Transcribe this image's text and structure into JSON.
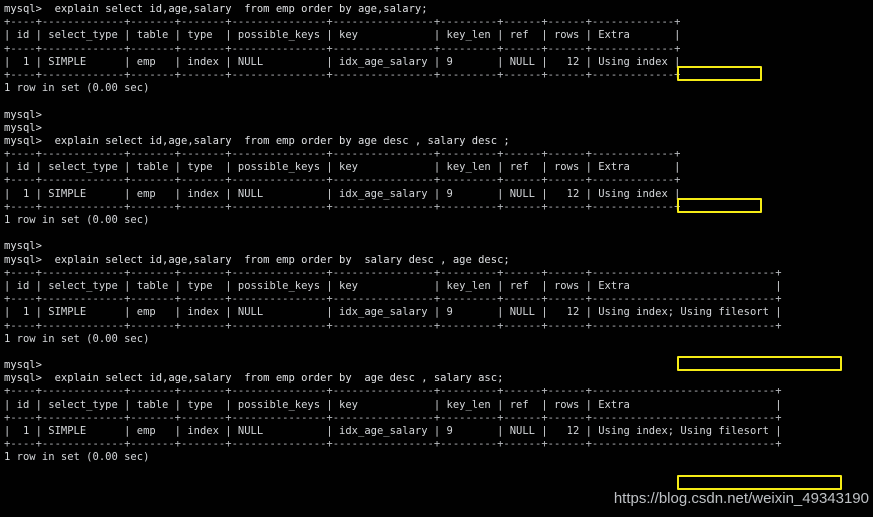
{
  "terminal": {
    "prompt": "mysql>",
    "colors": {
      "background": "#010101",
      "text": "#d4d7da",
      "highlight_border": "#f5eb16",
      "watermark": "#cfd2d6"
    },
    "lines": [
      "mysql>  explain select id,age,salary  from emp order by age,salary;",
      "+----+-------------+-------+-------+---------------+----------------+---------+------+------+-------------+",
      "| id | select_type | table | type  | possible_keys | key            | key_len | ref  | rows | Extra       |",
      "+----+-------------+-------+-------+---------------+----------------+---------+------+------+-------------+",
      "|  1 | SIMPLE      | emp   | index | NULL          | idx_age_salary | 9       | NULL |   12 | Using index |",
      "+----+-------------+-------+-------+---------------+----------------+---------+------+------+-------------+",
      "1 row in set (0.00 sec)",
      "",
      "mysql>",
      "mysql>",
      "mysql>  explain select id,age,salary  from emp order by age desc , salary desc ;",
      "+----+-------------+-------+-------+---------------+----------------+---------+------+------+-------------+",
      "| id | select_type | table | type  | possible_keys | key            | key_len | ref  | rows | Extra       |",
      "+----+-------------+-------+-------+---------------+----------------+---------+------+------+-------------+",
      "|  1 | SIMPLE      | emp   | index | NULL          | idx_age_salary | 9       | NULL |   12 | Using index |",
      "+----+-------------+-------+-------+---------------+----------------+---------+------+------+-------------+",
      "1 row in set (0.00 sec)",
      "",
      "mysql>",
      "mysql>  explain select id,age,salary  from emp order by  salary desc , age desc;",
      "+----+-------------+-------+-------+---------------+----------------+---------+------+------+-----------------------------+",
      "| id | select_type | table | type  | possible_keys | key            | key_len | ref  | rows | Extra                       |",
      "+----+-------------+-------+-------+---------------+----------------+---------+------+------+-----------------------------+",
      "|  1 | SIMPLE      | emp   | index | NULL          | idx_age_salary | 9       | NULL |   12 | Using index; Using filesort |",
      "+----+-------------+-------+-------+---------------+----------------+---------+------+------+-----------------------------+",
      "1 row in set (0.00 sec)",
      "",
      "mysql>",
      "mysql>  explain select id,age,salary  from emp order by  age desc , salary asc;",
      "+----+-------------+-------+-------+---------------+----------------+---------+------+------+-----------------------------+",
      "| id | select_type | table | type  | possible_keys | key            | key_len | ref  | rows | Extra                       |",
      "+----+-------------+-------+-------+---------------+----------------+---------+------+------+-----------------------------+",
      "|  1 | SIMPLE      | emp   | index | NULL          | idx_age_salary | 9       | NULL |   12 | Using index; Using filesort |",
      "+----+-------------+-------+-------+---------------+----------------+---------+------+------+-----------------------------+",
      "1 row in set (0.00 sec)"
    ],
    "queries": [
      {
        "sql": "explain select id,age,salary  from emp order by age,salary;",
        "result_status": "1 row in set (0.00 sec)",
        "columns": [
          "id",
          "select_type",
          "table",
          "type",
          "possible_keys",
          "key",
          "key_len",
          "ref",
          "rows",
          "Extra"
        ],
        "row": [
          "1",
          "SIMPLE",
          "emp",
          "index",
          "NULL",
          "idx_age_salary",
          "9",
          "NULL",
          "12",
          "Using index"
        ],
        "highlighted_extra": "Using index"
      },
      {
        "sql": "explain select id,age,salary  from emp order by age desc , salary desc ;",
        "result_status": "1 row in set (0.00 sec)",
        "columns": [
          "id",
          "select_type",
          "table",
          "type",
          "possible_keys",
          "key",
          "key_len",
          "ref",
          "rows",
          "Extra"
        ],
        "row": [
          "1",
          "SIMPLE",
          "emp",
          "index",
          "NULL",
          "idx_age_salary",
          "9",
          "NULL",
          "12",
          "Using index"
        ],
        "highlighted_extra": "Using index"
      },
      {
        "sql": "explain select id,age,salary  from emp order by  salary desc , age desc;",
        "result_status": "1 row in set (0.00 sec)",
        "columns": [
          "id",
          "select_type",
          "table",
          "type",
          "possible_keys",
          "key",
          "key_len",
          "ref",
          "rows",
          "Extra"
        ],
        "row": [
          "1",
          "SIMPLE",
          "emp",
          "index",
          "NULL",
          "idx_age_salary",
          "9",
          "NULL",
          "12",
          "Using index; Using filesort"
        ],
        "highlighted_extra": "Using index; Using filesort"
      },
      {
        "sql": "explain select id,age,salary  from emp order by  age desc , salary asc;",
        "result_status": "1 row in set (0.00 sec)",
        "columns": [
          "id",
          "select_type",
          "table",
          "type",
          "possible_keys",
          "key",
          "key_len",
          "ref",
          "rows",
          "Extra"
        ],
        "row": [
          "1",
          "SIMPLE",
          "emp",
          "index",
          "NULL",
          "idx_age_salary",
          "9",
          "NULL",
          "12",
          "Using index; Using filesort"
        ],
        "highlighted_extra": "Using index; Using filesort"
      }
    ]
  },
  "watermark": {
    "text": "https://blog.csdn.net/weixin_49343190"
  }
}
